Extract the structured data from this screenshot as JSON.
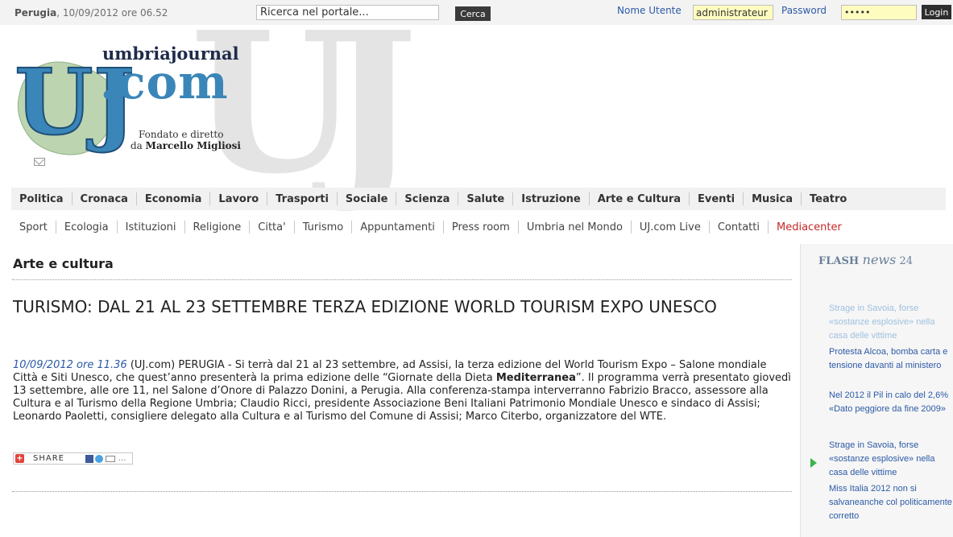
{
  "topbar": {
    "city": "Perugia",
    "datetime": ", 10/09/2012 ore 06.52",
    "search_value": "Ricerca nel portale...",
    "search_button": "Cerca",
    "username_label": "Nome Utente",
    "username_value": "administrateur",
    "password_label": "Password",
    "password_value": "•••••",
    "login_button": "Login"
  },
  "logo": {
    "watermark": "UJ",
    "letters": "UJ",
    "name_top": "umbriajournal",
    "name_com": ".com",
    "founded": "Fondato e diretto",
    "director_prefix": "da ",
    "director": "Marcello Migliosi"
  },
  "nav_primary": [
    "Politica",
    "Cronaca",
    "Economia",
    "Lavoro",
    "Trasporti",
    "Sociale",
    "Scienza",
    "Salute",
    "Istruzione",
    "Arte e Cultura",
    "Eventi",
    "Musica",
    "Teatro"
  ],
  "nav_secondary": [
    "Sport",
    "Ecologia",
    "Istituzioni",
    "Religione",
    "Citta'",
    "Turismo",
    "Appuntamenti",
    "Press room",
    "Umbria nel Mondo",
    "UJ.com Live",
    "Contatti",
    "Mediacenter"
  ],
  "main": {
    "section_title": "Arte e cultura",
    "article_title": "TURISMO: DAL 21 AL 23 SETTEMBRE TERZA EDIZIONE WORLD TOURISM EXPO UNESCO",
    "article_date": "10/09/2012 ore 11.36",
    "body_part1": " (UJ.com) PERUGIA - Si terrà dal 21 al 23 settembre, ad Assisi, la terza edizione del World Tourism Expo – Salone mondiale Città e Siti Unesco, che quest’anno presenterà la prima edizione delle “Giornate della Dieta ",
    "body_bold": "Mediterranea",
    "body_part2": "”. Il programma verrà presentato giovedì 13 settembre, alle ore 11, nel Salone d’Onore di Palazzo Donini, a Perugia. Alla conferenza-stampa interverranno Fabrizio Bracco, assessore alla Cultura e al Turismo della Regione Umbria; Claudio Ricci, presidente Associazione Beni Italiani Patrimonio Mondiale Unesco e sindaco di Assisi; Leonardo Paoletti, consigliere delegato alla Cultura e al Turismo del Comune di Assisi; Marco Citerbo, organizzatore del WTE.",
    "share_label": "SHARE",
    "share_more": "..."
  },
  "sidebar": {
    "flash_title": "FLASH ",
    "flash_news": "news",
    "flash_num": " 24",
    "items": [
      "Strage in Savoia, forse «sostanze esplosive» nella casa delle vittime",
      "Protesta Alcoa, bomba carta e tensione davanti al ministero",
      "Nel 2012 il Pil in calo del 2,6% «Dato peggiore da fine 2009»",
      "Strage in Savoia, forse «sostanze esplosive» nella casa delle vittime",
      "Miss Italia 2012 non si salvaneanche col politicamente corretto"
    ]
  },
  "colors": {
    "link_blue": "#2c5aa6",
    "logo_blue": "#3a86b8",
    "accent_red": "#c62828",
    "flash_arrow": "#3bb34a"
  }
}
